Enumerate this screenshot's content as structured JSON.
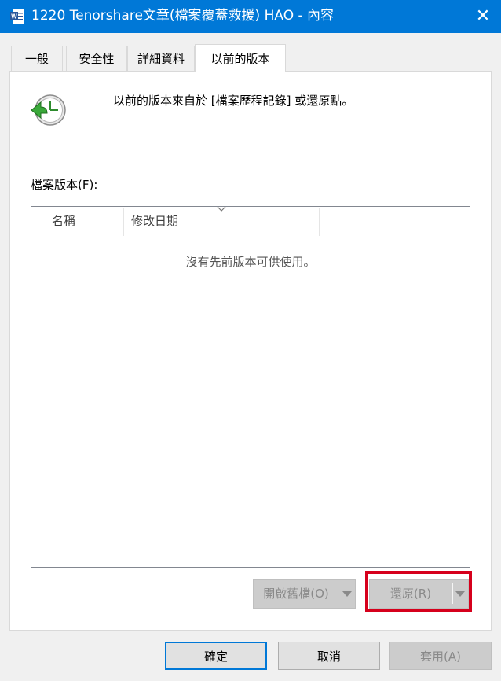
{
  "window": {
    "title": "1220 Tenorshare文章(檔案覆蓋救援) HAO - 內容",
    "close_glyph": "✕",
    "titlebar_color": "#0078d7"
  },
  "tabs": [
    {
      "label": "一般"
    },
    {
      "label": "安全性"
    },
    {
      "label": "詳細資料"
    },
    {
      "label": "以前的版本",
      "active": true
    }
  ],
  "previous_versions": {
    "header_text": "以前的版本來自於 [檔案歷程記錄] 或還原點。",
    "versions_label": "檔案版本(F):",
    "columns": [
      "名稱",
      "修改日期"
    ],
    "empty_message": "沒有先前版本可供使用。",
    "open_button": "開啟舊檔(O)",
    "restore_button": "還原(R)",
    "highlight_color": "#d6001c"
  },
  "dialog_buttons": {
    "ok": "確定",
    "cancel": "取消",
    "apply": "套用(A)"
  }
}
